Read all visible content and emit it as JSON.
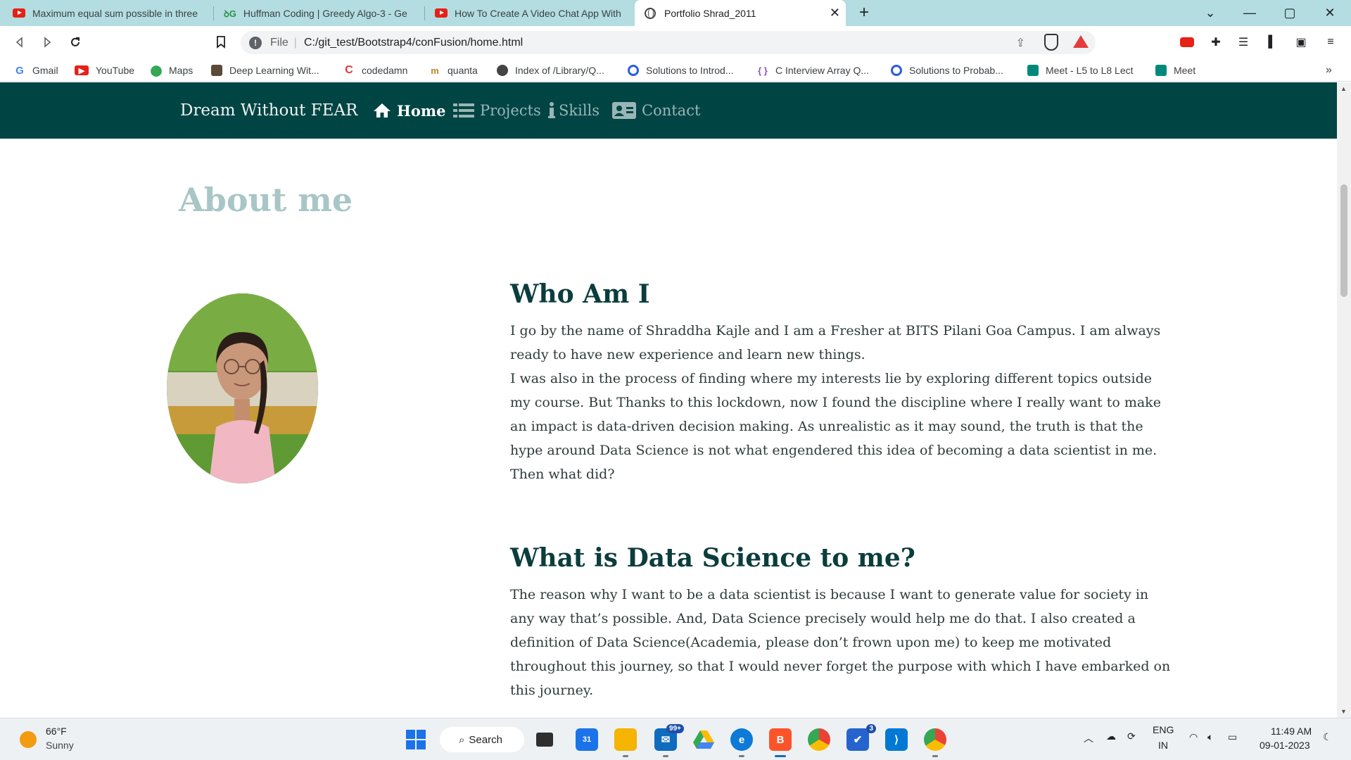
{
  "tabs": [
    {
      "title": "Maximum equal sum possible in three",
      "icon": "youtube-icon",
      "active": false
    },
    {
      "title": "Huffman Coding | Greedy Algo-3 - Ge",
      "icon": "geeksforgeeks-icon",
      "active": false
    },
    {
      "title": "How To Create A Video Chat App With",
      "icon": "youtube-icon",
      "active": false
    },
    {
      "title": "Portfolio Shrad_2011",
      "icon": "globe-icon",
      "active": true
    }
  ],
  "window_controls": {
    "minimize": "—",
    "maximize": "▢",
    "close": "✕",
    "new_tab": "+",
    "tab_search": "⌄"
  },
  "address_bar": {
    "scheme": "File",
    "url": "C:/git_test/Bootstrap4/conFusion/home.html"
  },
  "bookmarks": [
    {
      "label": "Gmail",
      "icon": "google-icon",
      "color": "#4285f4"
    },
    {
      "label": "YouTube",
      "icon": "youtube-icon",
      "color": "#e62117"
    },
    {
      "label": "Maps",
      "icon": "maps-pin-icon",
      "color": "#34a853"
    },
    {
      "label": "Deep Learning Wit...",
      "icon": "book-icon",
      "color": "#5b4a3a"
    },
    {
      "label": "codedamn",
      "icon": "codedamn-icon",
      "color": "#e53935"
    },
    {
      "label": "quanta",
      "icon": "quanta-icon",
      "color": "#c0842a"
    },
    {
      "label": "Index of /Library/Q...",
      "icon": "globe-icon",
      "color": "#444444"
    },
    {
      "label": "Solutions to Introd...",
      "icon": "search-q-icon",
      "color": "#2d5be3"
    },
    {
      "label": "C Interview Array Q...",
      "icon": "code-braces-icon",
      "color": "#7e57c2"
    },
    {
      "label": "Solutions to Probab...",
      "icon": "search-q-icon",
      "color": "#2d5be3"
    },
    {
      "label": "Meet - L5 to L8 Lect",
      "icon": "meet-icon",
      "color": "#00897b"
    },
    {
      "label": "Meet",
      "icon": "meet-icon",
      "color": "#00897b"
    }
  ],
  "bookmarks_more": "»",
  "site": {
    "brand": "Dream Without FEAR",
    "nav": [
      {
        "label": "Home",
        "icon": "home-icon",
        "active": true
      },
      {
        "label": "Projects",
        "icon": "list-icon",
        "active": false
      },
      {
        "label": "Skills",
        "icon": "info-icon",
        "active": false
      },
      {
        "label": "Contact",
        "icon": "address-card-icon",
        "active": false
      }
    ],
    "about_heading": "About me",
    "sections": [
      {
        "heading": "Who Am I",
        "paragraphs": [
          "I go by the name of Shraddha Kajle and I am a Fresher at BITS Pilani Goa Campus. I am always ready to have new experience and learn new things.",
          "I was also in the process of finding where my interests lie by exploring different topics outside my course. But Thanks to this lockdown, now I found the discipline where I really want to make an impact is data-driven decision making. As unrealistic as it may sound, the truth is that the hype around Data Science is not what engendered this idea of becoming a data scientist in me. Then what did?"
        ]
      },
      {
        "heading": "What is Data Science to me?",
        "paragraphs": [
          "The reason why I want to be a data scientist is because I want to generate value for society in any way that’s possible. And, Data Science precisely would help me do that. I also created a definition of Data Science(Academia, please don’t frown upon me) to keep me motivated throughout this journey, so that I would never forget the purpose with which I have embarked on this journey."
        ]
      }
    ]
  },
  "taskbar": {
    "weather_temp": "66°F",
    "weather_desc": "Sunny",
    "search_label": "Search",
    "mail_badge": "99+",
    "todo_badge": "3",
    "language": "ENG",
    "region": "IN",
    "time": "11:49 AM",
    "date": "09-01-2023"
  }
}
